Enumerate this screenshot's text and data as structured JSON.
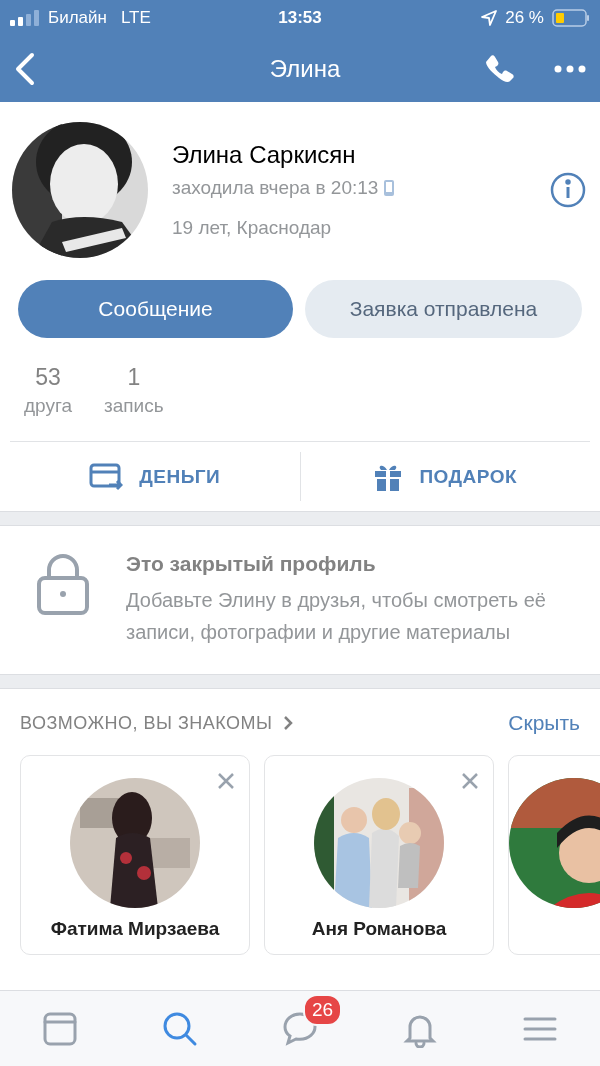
{
  "status_bar": {
    "carrier": "Билайн",
    "network": "LTE",
    "time": "13:53",
    "battery": "26 %"
  },
  "nav": {
    "title": "Элина"
  },
  "profile": {
    "name": "Элина Саркисян",
    "last_seen": "заходила вчера в 20:13",
    "info": "19 лет, Краснодар"
  },
  "buttons": [
    {
      "label": "Сообщение",
      "kind": "primary"
    },
    {
      "label": "Заявка отправлена",
      "kind": "secondary"
    }
  ],
  "counters": [
    {
      "value": "53",
      "label": "друга"
    },
    {
      "value": "1",
      "label": "запись"
    }
  ],
  "actions": [
    {
      "label": "ДЕНЬГИ",
      "kind": "money"
    },
    {
      "label": "ПОДАРОК",
      "kind": "gift"
    }
  ],
  "private": {
    "title": "Это закрытый профиль",
    "text": "Добавьте Элину в друзья, чтобы смотреть её записи, фотографии и другие материалы"
  },
  "suggestions": {
    "title": "ВОЗМОЖНО, ВЫ ЗНАКОМЫ",
    "hide": "Скрыть",
    "people": [
      {
        "kind": "person",
        "name": "Фатима Мирзаева"
      },
      {
        "kind": "person",
        "name": "Аня Романова"
      },
      {
        "kind": "partial"
      }
    ]
  },
  "tab_bar": [
    {
      "kind": "news",
      "selected": false
    },
    {
      "kind": "search",
      "selected": true
    },
    {
      "kind": "messages",
      "selected": false,
      "badge": "26"
    },
    {
      "kind": "notifications",
      "selected": false
    },
    {
      "kind": "menu",
      "selected": false
    }
  ]
}
